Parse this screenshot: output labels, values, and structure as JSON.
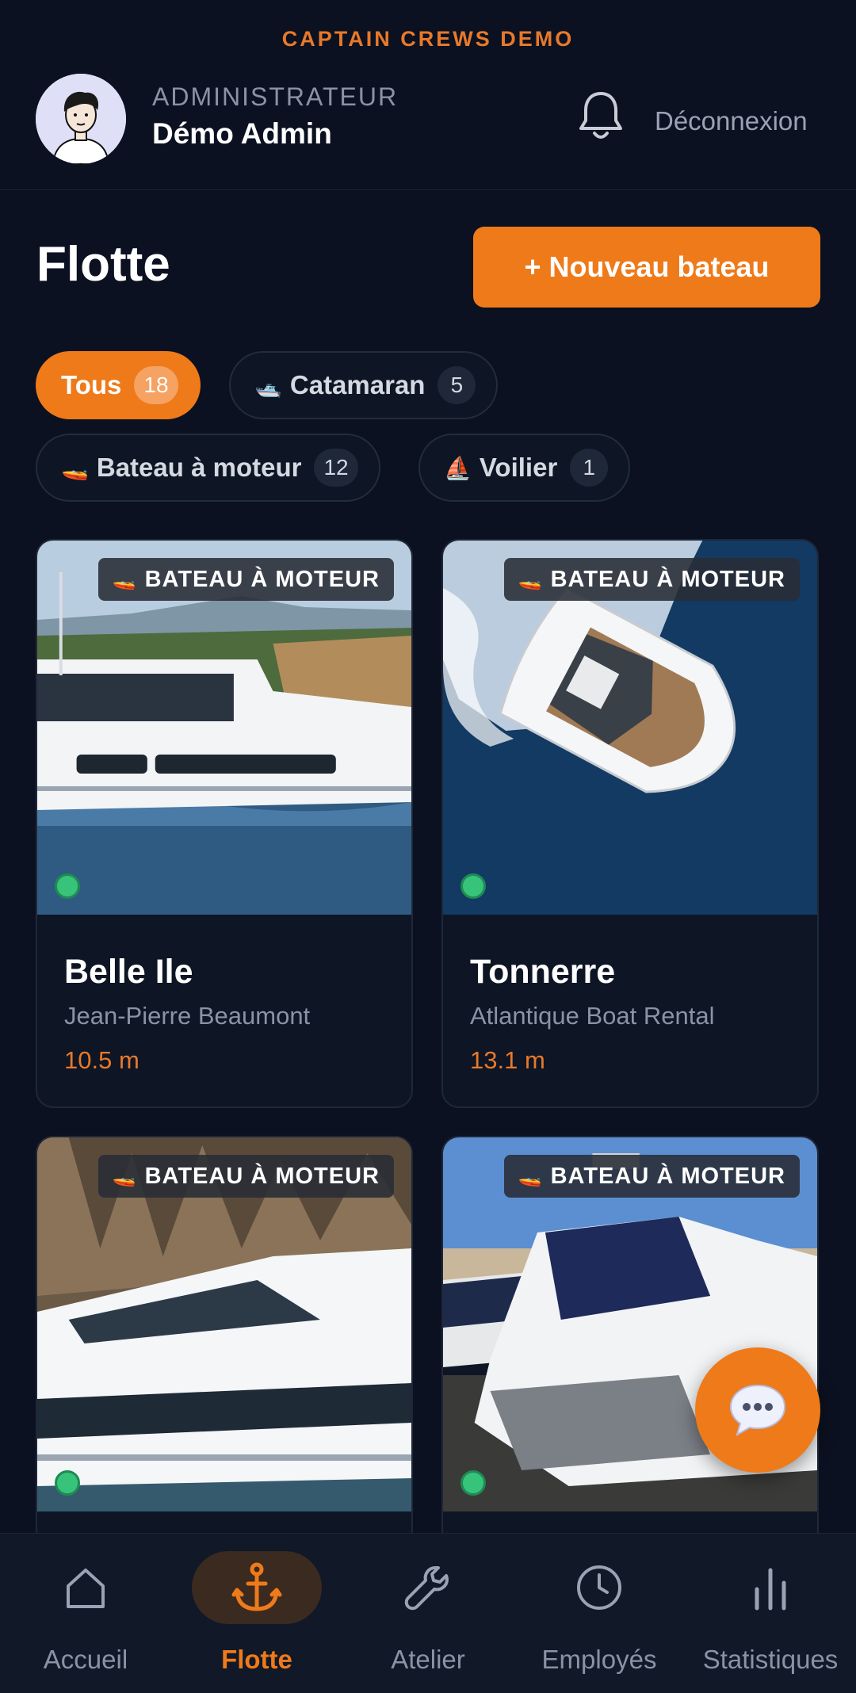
{
  "brand": "CAPTAIN CREWS DEMO",
  "header": {
    "role": "ADMINISTRATEUR",
    "username": "Démo Admin",
    "logout_label": "Déconnexion",
    "bell_icon": "bell-icon",
    "avatar_icon": "user-avatar"
  },
  "page": {
    "title": "Flotte",
    "new_boat_label": "+ Nouveau bateau"
  },
  "filters": [
    {
      "emoji": "",
      "label": "Tous",
      "count": "18",
      "active": true
    },
    {
      "emoji": "🛥️",
      "label": "Catamaran",
      "count": "5",
      "active": false
    },
    {
      "emoji": "🚤",
      "label": "Bateau à moteur",
      "count": "12",
      "active": false
    },
    {
      "emoji": "⛵",
      "label": "Voilier",
      "count": "1",
      "active": false
    }
  ],
  "boats": [
    {
      "badge": "BATEAU À MOTEUR",
      "badge_emoji": "🚤",
      "name": "Belle Ile",
      "owner": "Jean-Pierre Beaumont",
      "length": "10.5 m",
      "status": "available"
    },
    {
      "badge": "BATEAU À MOTEUR",
      "badge_emoji": "🚤",
      "name": "Tonnerre",
      "owner": "Atlantique Boat Rental",
      "length": "13.1 m",
      "status": "available"
    },
    {
      "badge": "BATEAU À MOTEUR",
      "badge_emoji": "🚤",
      "name": "",
      "owner": "",
      "length": "",
      "status": "available"
    },
    {
      "badge": "BATEAU À MOTEUR",
      "badge_emoji": "🚤",
      "name": "",
      "owner": "",
      "length": "",
      "status": "available"
    }
  ],
  "chat_icon": "chat-bubble-icon",
  "nav": [
    {
      "label": "Accueil",
      "icon": "home-icon",
      "active": false
    },
    {
      "label": "Flotte",
      "icon": "anchor-icon",
      "active": true
    },
    {
      "label": "Atelier",
      "icon": "wrench-icon",
      "active": false
    },
    {
      "label": "Employés",
      "icon": "clock-icon",
      "active": false
    },
    {
      "label": "Statistiques",
      "icon": "bar-chart-icon",
      "active": false
    }
  ],
  "colors": {
    "accent": "#ef7a1a",
    "background": "#0b1120",
    "status_available": "#37c47a"
  }
}
